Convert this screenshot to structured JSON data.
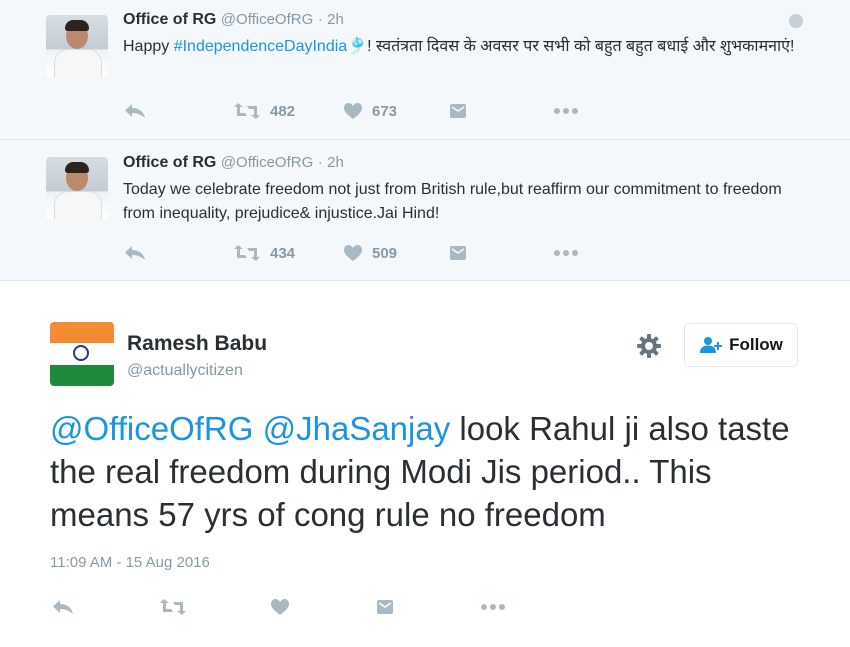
{
  "thread": [
    {
      "author_name": "Office of RG",
      "author_handle": "@OfficeOfRG",
      "separator": "·",
      "age": "2h",
      "text_prefix": "Happy ",
      "hashtag": "#IndependenceDayIndia",
      "emoji": "🎐",
      "text_suffix": "! स्वतंत्रता दिवस के अवसर पर सभी को बहुत बहुत बधाई और शुभकामनाएं!",
      "retweets": "482",
      "likes": "673"
    },
    {
      "author_name": "Office of RG",
      "author_handle": "@OfficeOfRG",
      "separator": "·",
      "age": "2h",
      "text": "Today we celebrate freedom not just from British rule,but reaffirm our commitment to freedom from inequality, prejudice& injustice.Jai Hind!",
      "retweets": "434",
      "likes": "509"
    }
  ],
  "main_tweet": {
    "author_name": "Ramesh Babu",
    "author_handle": "@actuallycitizen",
    "follow_label": "Follow",
    "mention_1": "@OfficeOfRG",
    "mention_2": "@JhaSanjay",
    "text": " look Rahul ji also taste the real freedom during Modi Jis period.. This means 57 yrs of cong rule no freedom",
    "timestamp": "11:09 AM - 15 Aug 2016"
  },
  "icons": [
    "reply-icon",
    "retweet-icon",
    "like-icon",
    "dm-icon",
    "more-icon",
    "globe-icon",
    "gear-icon",
    "follow-user-icon"
  ],
  "colors": {
    "link": "#1b95e0",
    "muted": "#8899a6",
    "icon": "#aab8c2",
    "thread_bg": "#f5f8fa"
  }
}
